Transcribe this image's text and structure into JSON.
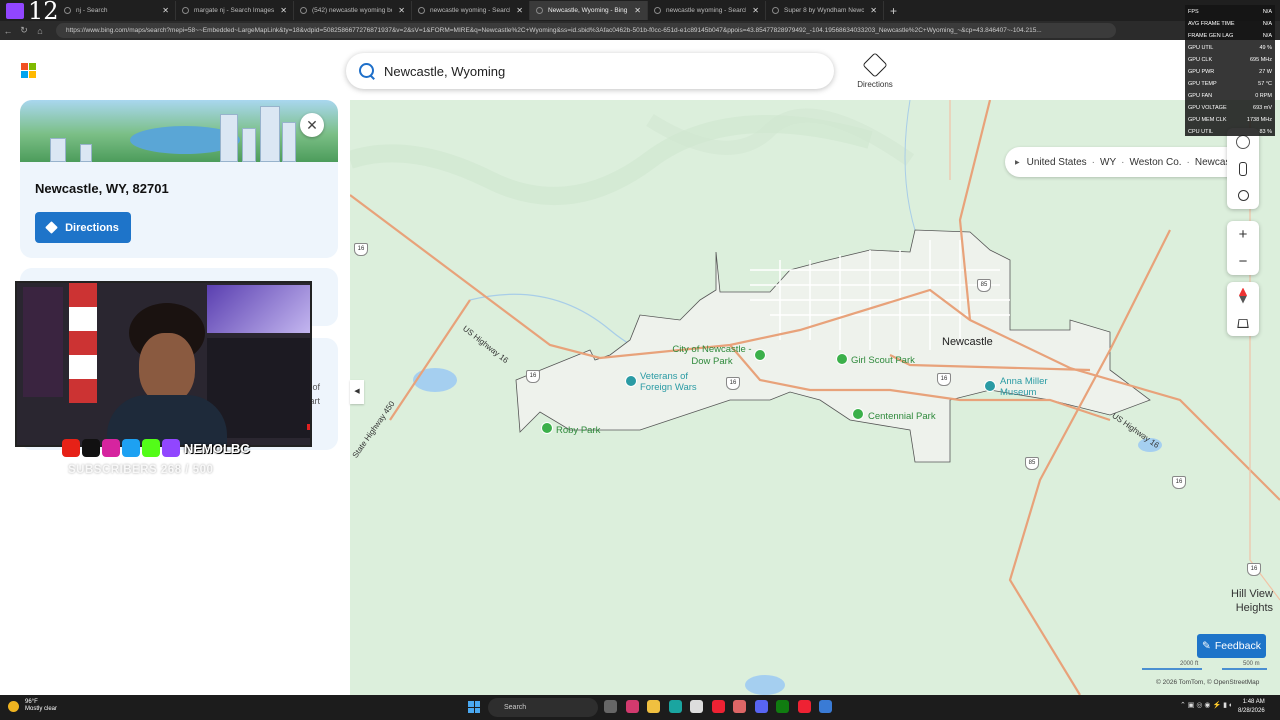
{
  "browser": {
    "overlay_number": "12",
    "tabs": [
      {
        "label": "nj - Search",
        "active": false
      },
      {
        "label": "margate nj - Search Images",
        "active": false
      },
      {
        "label": "(542) newcastle wyoming bodycam",
        "active": false
      },
      {
        "label": "newcastle wyoming - Search",
        "active": false
      },
      {
        "label": "Newcastle, Wyoming - Bing Maps",
        "active": true
      },
      {
        "label": "newcastle wyoming - Search Imag",
        "active": false
      },
      {
        "label": "Super 8 by Wyndham Newcastle",
        "active": false
      }
    ],
    "url": "https://www.bing.com/maps/search?mepi=58~~Embedded~LargeMapLink&ty=18&vdpid=5082586677276871937&v=2&sV=1&FORM=MIRE&q=Newcastle%2C+Wyoming&ss=id.sbid%3Afac0462b-501b-f0cc-651d-e1c89145b047&ppois=43.85477828979492_-104.19568634033203_Newcastle%2C+Wyoming_~&cp=43.846407~-104.215..."
  },
  "stats_overlay": [
    {
      "label": "FPS",
      "value": "N/A"
    },
    {
      "label": "AVG FRAME TIME",
      "value": "N/A"
    },
    {
      "label": "FRAME GEN LAG",
      "value": "N/A"
    },
    {
      "label": "GPU UTIL",
      "value": "49 %"
    },
    {
      "label": "GPU CLK",
      "value": "695 MHz"
    },
    {
      "label": "GPU PWR",
      "value": "27 W"
    },
    {
      "label": "GPU TEMP",
      "value": "57 °C"
    },
    {
      "label": "GPU FAN",
      "value": "0 RPM"
    },
    {
      "label": "GPU VOLTAGE",
      "value": "693 mV"
    },
    {
      "label": "GPU MEM CLK",
      "value": "1738 MHz"
    },
    {
      "label": "CPU UTIL",
      "value": "83 %"
    }
  ],
  "search": {
    "value": "Newcastle, Wyoming"
  },
  "header": {
    "directions_label": "Directions"
  },
  "place_card": {
    "title": "Newcastle, WY, 82701",
    "directions_label": "Directions",
    "partial_text_1": "of",
    "partial_text_2": "art"
  },
  "stream": {
    "handle": "NEMOLBC",
    "subscribers": "SUBSCRIBERS 268 / 500"
  },
  "breadcrumb": [
    "United States",
    "WY",
    "Weston Co.",
    "Newcastle"
  ],
  "map": {
    "city": "Newcastle",
    "parks": [
      "City of Newcastle - Dow Park",
      "Girl Scout Park",
      "Centennial Park",
      "Roby Park"
    ],
    "poi_veterans": "Veterans of Foreign Wars",
    "poi_museum": "Anna Miller Museum",
    "road_labels": [
      "US Highway 16",
      "State Highway 450",
      "US Highway 16"
    ],
    "shields": [
      "16",
      "16",
      "16",
      "85",
      "16",
      "16",
      "85",
      "85",
      "16"
    ],
    "hill_view": "Hill View Heights",
    "scale_ft": "2000 ft",
    "scale_m": "500 m",
    "copyright": "© 2026 TomTom, © OpenStreetMap",
    "feedback_label": "Feedback"
  },
  "taskbar": {
    "temp": "96°F",
    "weather": "Mostly clear",
    "search_label": "Search",
    "time": "1:48 AM",
    "date": "8/28/2026"
  },
  "colors": {
    "accent": "#1e74c9",
    "map_bg": "#dcefdc",
    "road": "#e8a27a",
    "park_green": "#2f8a3c"
  }
}
